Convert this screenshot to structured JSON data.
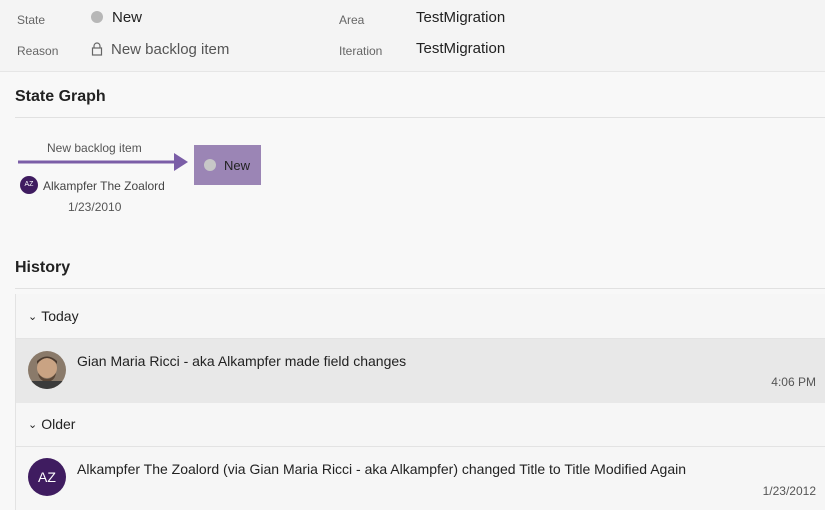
{
  "fields": {
    "state_label": "State",
    "state_value": "New",
    "reason_label": "Reason",
    "reason_value": "New backlog item",
    "area_label": "Area",
    "area_value": "TestMigration",
    "iteration_label": "Iteration",
    "iteration_value": "TestMigration"
  },
  "state_graph": {
    "title": "State Graph",
    "transition_label": "New backlog item",
    "state": "New",
    "user_initials": "AZ",
    "user": "Alkampfer The Zoalord",
    "date": "1/23/2010"
  },
  "history": {
    "title": "History",
    "groups": [
      {
        "label": "Today",
        "entries": [
          {
            "text": "Gian Maria Ricci - aka Alkampfer made field changes",
            "time": "4:06 PM"
          }
        ]
      },
      {
        "label": "Older",
        "entries": [
          {
            "avatar_initials": "AZ",
            "text": "Alkampfer The Zoalord (via Gian Maria Ricci - aka Alkampfer) changed Title to Title Modified Again",
            "time": "1/23/2012"
          }
        ]
      }
    ]
  },
  "colors": {
    "state_box": "#9b85b5",
    "arrow": "#7b5ea7",
    "avatar_bg": "#3f1c60",
    "selected_row": "#e8e8e8"
  }
}
